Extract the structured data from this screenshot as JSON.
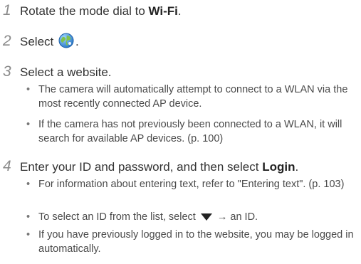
{
  "steps": [
    {
      "num": "1",
      "pre": "Rotate the mode dial to ",
      "bold": "Wi-Fi",
      "post": "."
    },
    {
      "num": "2",
      "pre": "Select ",
      "post": "."
    },
    {
      "num": "3",
      "text": "Select a website."
    },
    {
      "num": "4",
      "pre": "Enter your ID and password, and then select ",
      "bold": "Login",
      "post": "."
    }
  ],
  "step3_bullets": [
    "The camera will automatically attempt to connect to a WLAN via the most recently connected AP device.",
    "If the camera has not previously been connected to a WLAN, it will search for available AP devices. (p. 100)"
  ],
  "step4_bullets": {
    "b1": "For information about entering text, refer to \"Entering text\". (p. 103)",
    "b2_pre": "To select an ID from the list, select ",
    "b2_post": " → an ID.",
    "b3": "If you have previously logged in to the website, you may be logged in automatically."
  },
  "bullet_char": "•",
  "icons": {
    "step2": "globe-icon",
    "step4_b2": "down-triangle-icon"
  }
}
